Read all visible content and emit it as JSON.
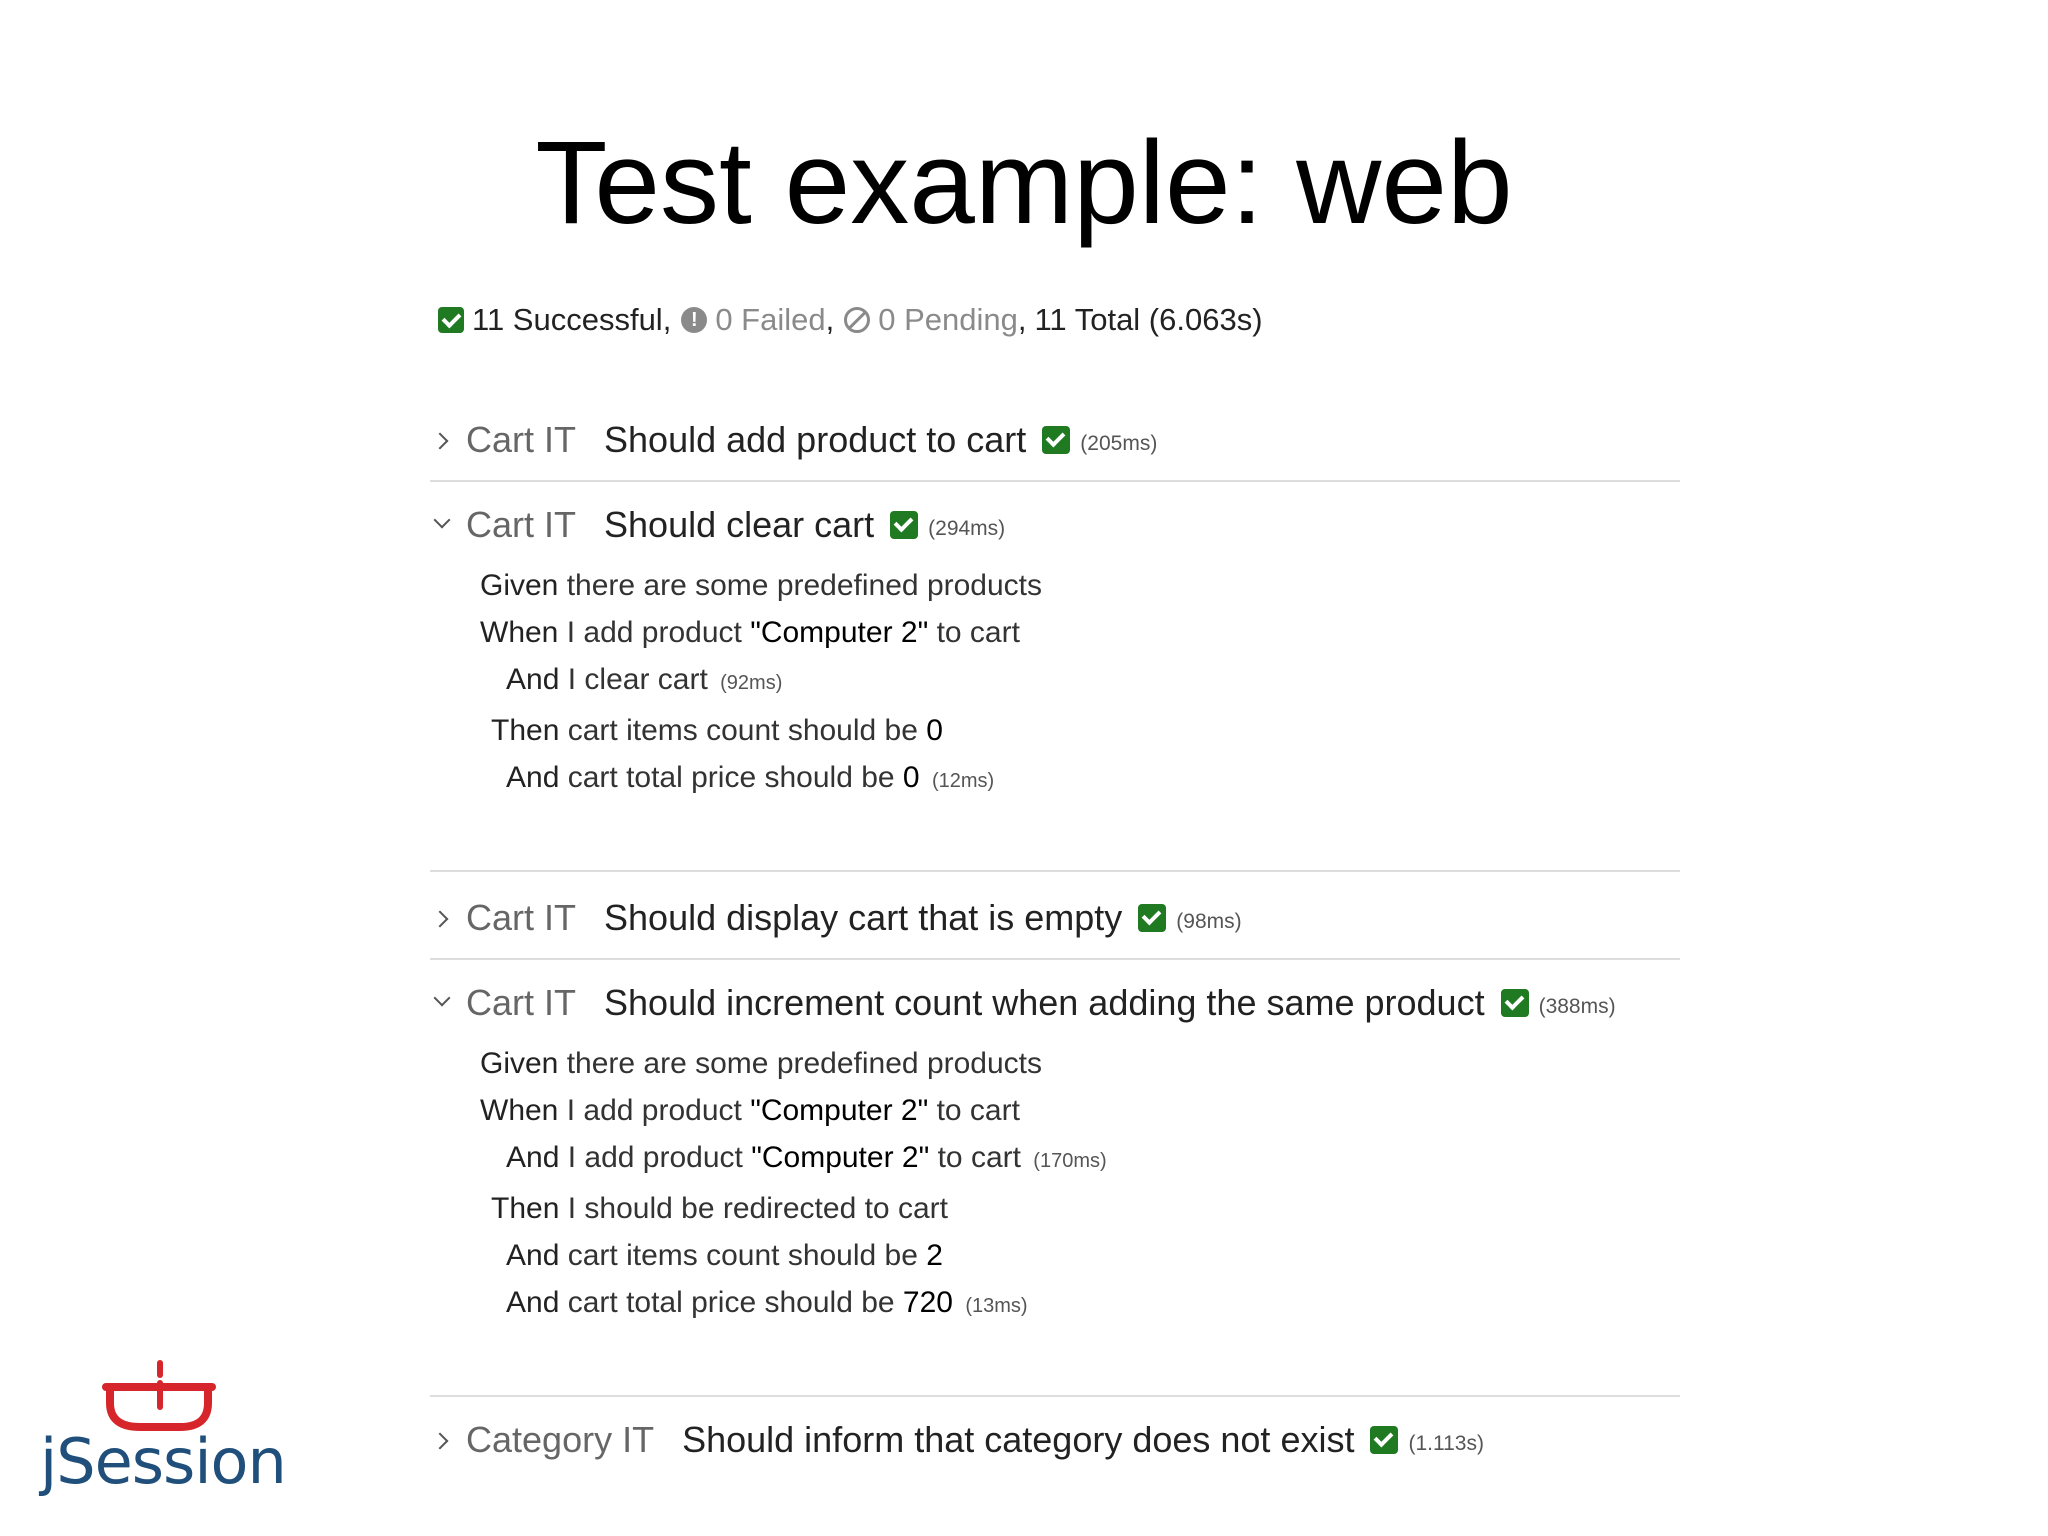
{
  "slide": {
    "title": "Test example: web"
  },
  "summary": {
    "successful": "11 Successful,",
    "failed": "0 Failed",
    "pending": "0 Pending",
    "total": "11 Total (6.063s)",
    "sep_comma": ","
  },
  "tests": [
    {
      "suite": "Cart IT",
      "name": "Should add product to cart",
      "duration": "(205ms)",
      "expanded": false
    },
    {
      "suite": "Cart IT",
      "name": "Should clear cart",
      "duration": "(294ms)",
      "expanded": true,
      "steps": [
        {
          "kw": "Given",
          "text": "there are some predefined products",
          "val": "",
          "tail": "",
          "dur": ""
        },
        {
          "kw": "When",
          "text": "I add product ",
          "val": "\"Computer 2\"",
          "tail": " to cart",
          "dur": ""
        },
        {
          "kw": "And",
          "text": "I clear cart",
          "val": "",
          "tail": "",
          "dur": "(92ms)"
        },
        {
          "kw": "Then",
          "text": "cart items count should be ",
          "val": "0",
          "tail": "",
          "dur": ""
        },
        {
          "kw": "And",
          "text": "cart total price should be ",
          "val": "0",
          "tail": "",
          "dur": "(12ms)"
        }
      ]
    },
    {
      "suite": "Cart IT",
      "name": "Should display cart that is empty",
      "duration": "(98ms)",
      "expanded": false
    },
    {
      "suite": "Cart IT",
      "name": "Should increment count when adding the same product",
      "duration": "(388ms)",
      "expanded": true,
      "steps": [
        {
          "kw": "Given",
          "text": "there are some predefined products",
          "val": "",
          "tail": "",
          "dur": ""
        },
        {
          "kw": "When",
          "text": "I add product ",
          "val": "\"Computer 2\"",
          "tail": " to cart",
          "dur": ""
        },
        {
          "kw": "And",
          "text": "I add product ",
          "val": "\"Computer 2\"",
          "tail": " to cart",
          "dur": "(170ms)"
        },
        {
          "kw": "Then",
          "text": "I should be redirected to cart",
          "val": "",
          "tail": "",
          "dur": ""
        },
        {
          "kw": "And",
          "text": "cart items count should be ",
          "val": "2",
          "tail": "",
          "dur": ""
        },
        {
          "kw": "And",
          "text": "cart total price should be ",
          "val": "720",
          "tail": "",
          "dur": "(13ms)"
        }
      ]
    },
    {
      "suite": "Category IT",
      "name": "Should inform that category does not exist",
      "duration": "(1.113s)",
      "expanded": false
    }
  ],
  "logo": {
    "text": "jSession",
    "cup_color": "#d7262b",
    "text_color": "#1f4f7a"
  },
  "colors": {
    "success": "#1f7a22",
    "muted": "#8a8a8a",
    "divider": "#dddddd"
  }
}
